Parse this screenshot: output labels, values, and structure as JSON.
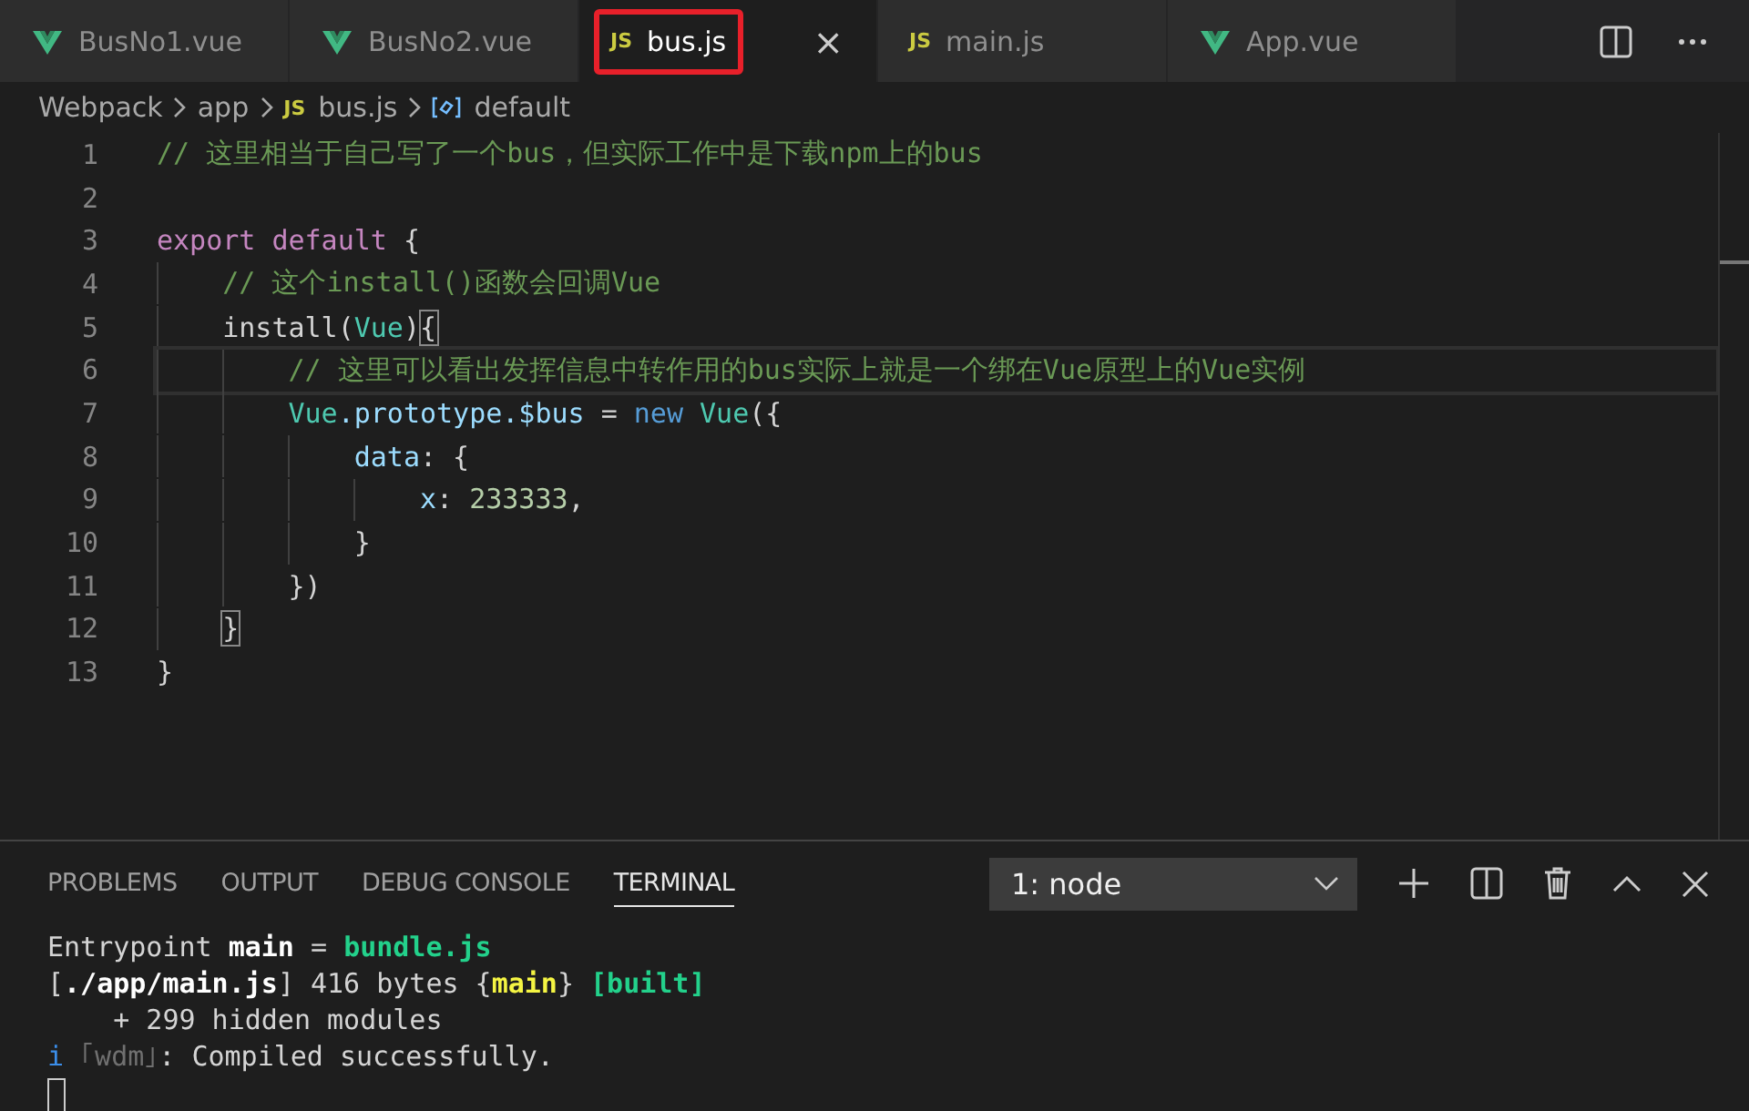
{
  "tabs": [
    {
      "label": "BusNo1.vue",
      "icon": {
        "kind": "vue"
      },
      "selected": false,
      "highlighted": false
    },
    {
      "label": "BusNo2.vue",
      "icon": {
        "kind": "vue"
      },
      "selected": false,
      "highlighted": false
    },
    {
      "label": "bus.js",
      "icon": {
        "kind": "js",
        "text": "JS"
      },
      "selected": true,
      "highlighted": true
    },
    {
      "label": "main.js",
      "icon": {
        "kind": "js",
        "text": "JS"
      },
      "selected": false,
      "highlighted": false
    },
    {
      "label": "App.vue",
      "icon": {
        "kind": "vue"
      },
      "selected": false,
      "highlighted": false
    }
  ],
  "close_tab": "×",
  "breadcrumbs": [
    {
      "label": "Webpack",
      "icon": {
        "kind": "none"
      }
    },
    {
      "label": "app",
      "icon": {
        "kind": "none"
      }
    },
    {
      "label": "bus.js",
      "icon": {
        "kind": "js",
        "text": "JS"
      }
    },
    {
      "label": "default",
      "icon": {
        "kind": "symbol"
      }
    }
  ],
  "code_lines": [
    {
      "number": "1",
      "current": false,
      "tokens": [
        {
          "kind": "comment",
          "text": "// 这里相当于自己写了一个bus，但实际工作中是下载npm上的bus"
        }
      ]
    },
    {
      "number": "2",
      "current": false
    },
    {
      "number": "3",
      "current": false,
      "tokens": [
        {
          "kind": "keyword",
          "text": "export default"
        },
        {
          "kind": "plain",
          "text": " {"
        }
      ]
    },
    {
      "number": "4",
      "current": false,
      "tokens": [
        {
          "kind": "comment",
          "text": "    // 这个install()函数会回调Vue"
        }
      ]
    },
    {
      "number": "5",
      "current": false,
      "tokens": [
        {
          "kind": "plain",
          "text": "    install("
        },
        {
          "kind": "type",
          "text": "Vue"
        },
        {
          "kind": "plain",
          "text": ")"
        },
        {
          "kind": "bracket",
          "text": "{"
        }
      ]
    },
    {
      "number": "6",
      "current": true,
      "tokens": [
        {
          "kind": "comment",
          "text": "        // 这里可以看出发挥信息中转作用的bus实际上就是一个绑在Vue原型上的Vue实例"
        }
      ]
    },
    {
      "number": "7",
      "current": false,
      "tokens": [
        {
          "kind": "type",
          "text": "        Vue"
        },
        {
          "kind": "variable",
          "text": ".prototype.$bus"
        },
        {
          "kind": "plain",
          "text": " = "
        },
        {
          "kind": "storage",
          "text": "new"
        },
        {
          "kind": "type",
          "text": " Vue"
        },
        {
          "kind": "plain",
          "text": "({"
        }
      ]
    },
    {
      "number": "8",
      "current": false,
      "tokens": [
        {
          "kind": "variable",
          "text": "            data"
        },
        {
          "kind": "plain",
          "text": ": {"
        }
      ]
    },
    {
      "number": "9",
      "current": false,
      "tokens": [
        {
          "kind": "variable",
          "text": "                x"
        },
        {
          "kind": "plain",
          "text": ": "
        },
        {
          "kind": "number",
          "text": "233333"
        },
        {
          "kind": "plain",
          "text": ","
        }
      ]
    },
    {
      "number": "10",
      "current": false,
      "tokens": [
        {
          "kind": "plain",
          "text": "            }"
        }
      ]
    },
    {
      "number": "11",
      "current": false,
      "tokens": [
        {
          "kind": "plain",
          "text": "        })"
        }
      ]
    },
    {
      "number": "12",
      "current": false,
      "tokens": [
        {
          "kind": "bracket",
          "text": "    }"
        }
      ]
    },
    {
      "number": "13",
      "current": false,
      "tokens": [
        {
          "kind": "plain",
          "text": "}"
        }
      ]
    }
  ],
  "panel": {
    "tabs": [
      {
        "label": "PROBLEMS",
        "selected": false
      },
      {
        "label": "OUTPUT",
        "selected": false
      },
      {
        "label": "DEBUG CONSOLE",
        "selected": false
      },
      {
        "label": "TERMINAL",
        "selected": true
      }
    ],
    "terminal_select": "1: node",
    "terminal_lines": [
      [
        {
          "kind": "plain",
          "text": "Entrypoint "
        },
        {
          "kind": "bold",
          "text": "main"
        },
        {
          "kind": "plain",
          "text": " = "
        },
        {
          "kind": "green",
          "text": "bundle.js"
        }
      ],
      [
        {
          "kind": "plain",
          "text": "["
        },
        {
          "kind": "bold",
          "text": "./app/main.js"
        },
        {
          "kind": "plain",
          "text": "] 416 bytes {"
        },
        {
          "kind": "yellow",
          "text": "main"
        },
        {
          "kind": "plain",
          "text": "} "
        },
        {
          "kind": "green",
          "text": "[built]"
        }
      ],
      [
        {
          "kind": "plain",
          "text": "    + 299 hidden modules"
        }
      ],
      [
        {
          "kind": "blue",
          "text": "i"
        },
        {
          "kind": "dim",
          "text": " ｢wdm｣"
        },
        {
          "kind": "plain",
          "text": ": Compiled successfully."
        }
      ]
    ]
  }
}
